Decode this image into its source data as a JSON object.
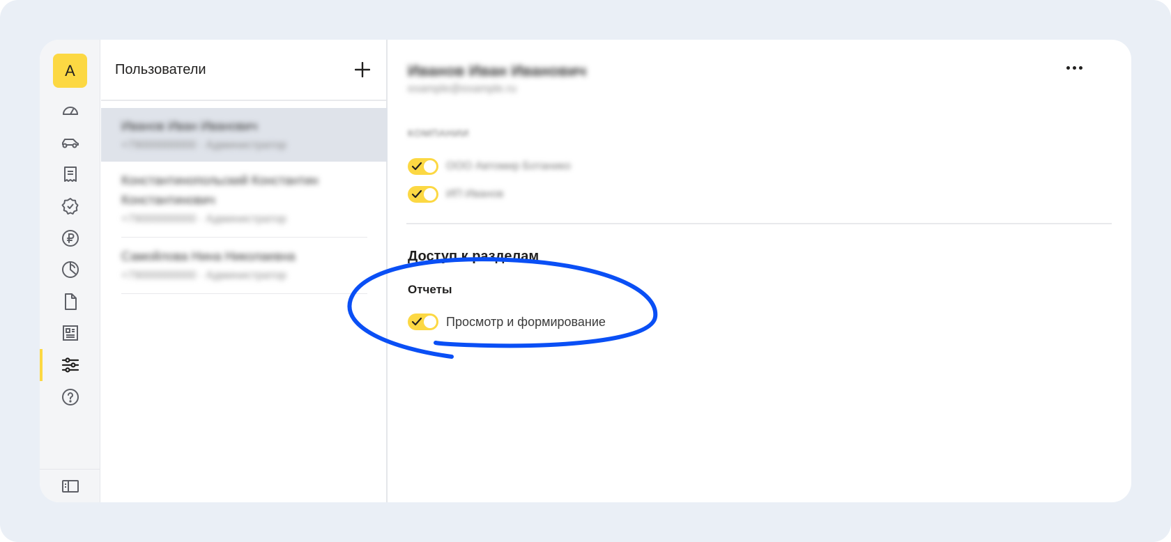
{
  "rail": {
    "avatar_letter": "A",
    "items": [
      {
        "icon": "dashboard-gauge-icon",
        "active": false
      },
      {
        "icon": "car-icon",
        "active": false
      },
      {
        "icon": "receipt-icon",
        "active": false
      },
      {
        "icon": "verified-badge-icon",
        "active": false
      },
      {
        "icon": "ruble-coin-icon",
        "active": false
      },
      {
        "icon": "pie-chart-icon",
        "active": false
      },
      {
        "icon": "document-icon",
        "active": false
      },
      {
        "icon": "newspaper-icon",
        "active": false
      },
      {
        "icon": "settings-sliders-icon",
        "active": true
      },
      {
        "icon": "help-circle-icon",
        "active": false
      }
    ],
    "bottom_icon": "sidebar-collapse-icon"
  },
  "users_panel": {
    "title": "Пользователи",
    "add_icon": "plus-icon",
    "users": [
      {
        "name": "Иванов Иван Иванович",
        "meta": "+79000000000 · Администратор",
        "selected": true
      },
      {
        "name": "Константинопольский Константин Константинович",
        "meta": "+79000000000 · Администратор",
        "selected": false
      },
      {
        "name": "Самойлова Нина Николаевна",
        "meta": "+79000000000 · Администратор",
        "selected": false
      }
    ]
  },
  "detail": {
    "name": "Иванов Иван Иванович",
    "email": "example@example.ru",
    "more_icon": "more-horizontal-icon",
    "companies_label": "КОМПАНИИ",
    "companies": [
      {
        "label": "ООО Автомир Ботанико",
        "enabled": true
      },
      {
        "label": "ИП Иванов",
        "enabled": true
      }
    ],
    "access_title": "Доступ к разделам",
    "reports_label": "Отчеты",
    "reports_permission": {
      "label": "Просмотр и формирование",
      "enabled": true
    }
  },
  "colors": {
    "accent": "#fcd843",
    "highlight_stroke": "#0a4ff5",
    "backdrop": "#eaeff6"
  }
}
